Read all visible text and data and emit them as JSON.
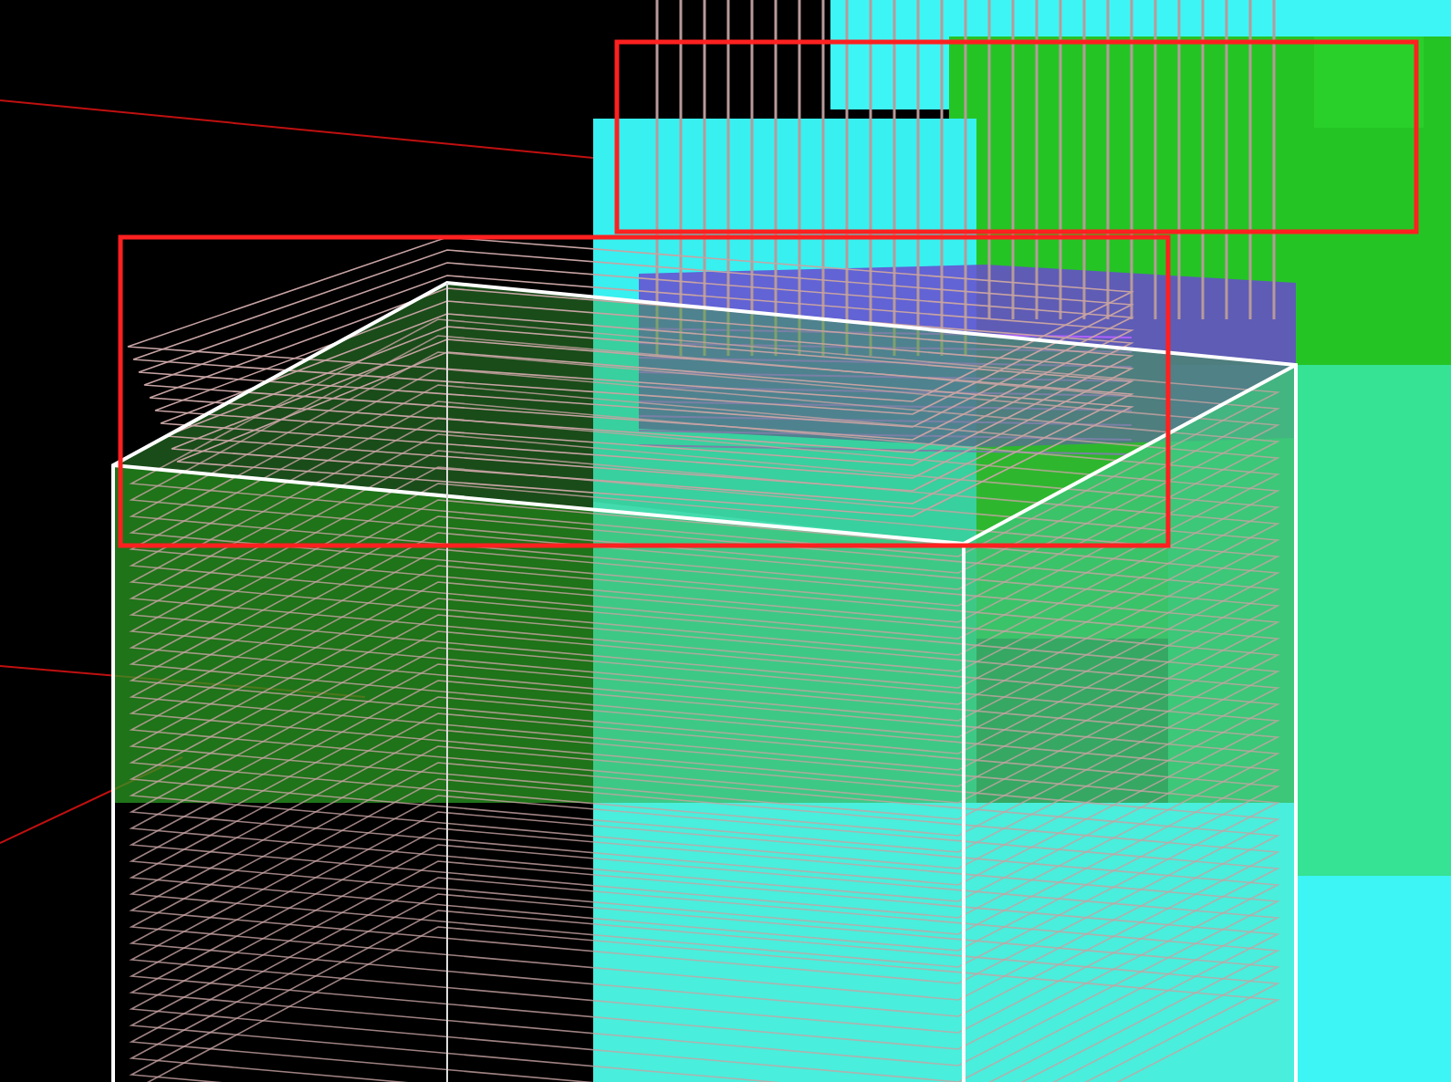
{
  "viewport": {
    "kind": "model-3d",
    "highlights": [
      {
        "kind": "rectangle"
      },
      {
        "kind": "rectangle"
      }
    ]
  }
}
